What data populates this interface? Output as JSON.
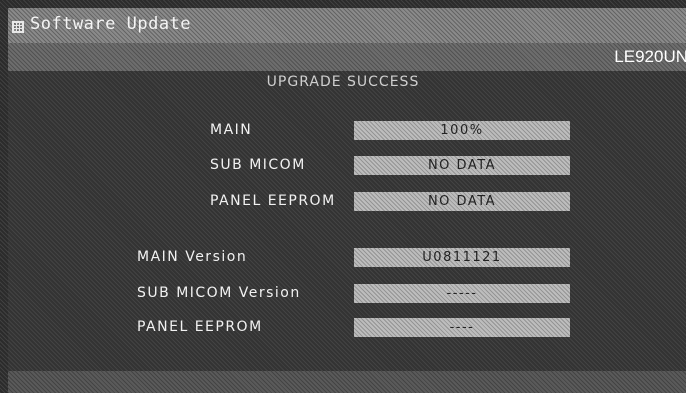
{
  "window": {
    "title": "Software Update",
    "model": "LE920UN"
  },
  "status": "UPGRADE SUCCESS",
  "progress": [
    {
      "label": "MAIN",
      "value": "100%"
    },
    {
      "label": "SUB MICOM",
      "value": "NO DATA"
    },
    {
      "label": "PANEL EEPROM",
      "value": "NO DATA"
    }
  ],
  "versions": [
    {
      "label": "MAIN Version",
      "value": "U0811121"
    },
    {
      "label": "SUB MICOM Version",
      "value": "-----"
    },
    {
      "label": "PANEL EEPROM",
      "value": "----"
    }
  ],
  "icons": {
    "title_icon": "grid-icon"
  }
}
